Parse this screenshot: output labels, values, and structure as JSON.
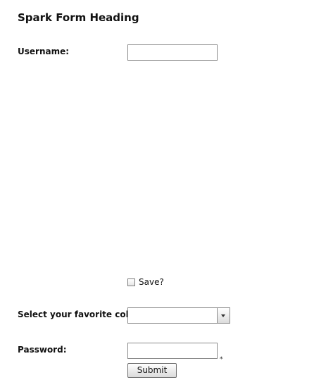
{
  "form": {
    "heading": "Spark Form Heading",
    "username": {
      "label": "Username:",
      "value": ""
    },
    "save": {
      "label": "Save?",
      "checked": false
    },
    "color": {
      "label": "Select your favorite color",
      "selected": ""
    },
    "password": {
      "label": "Password:",
      "value": "",
      "required_marker": "*"
    },
    "submit_label": "Submit"
  }
}
